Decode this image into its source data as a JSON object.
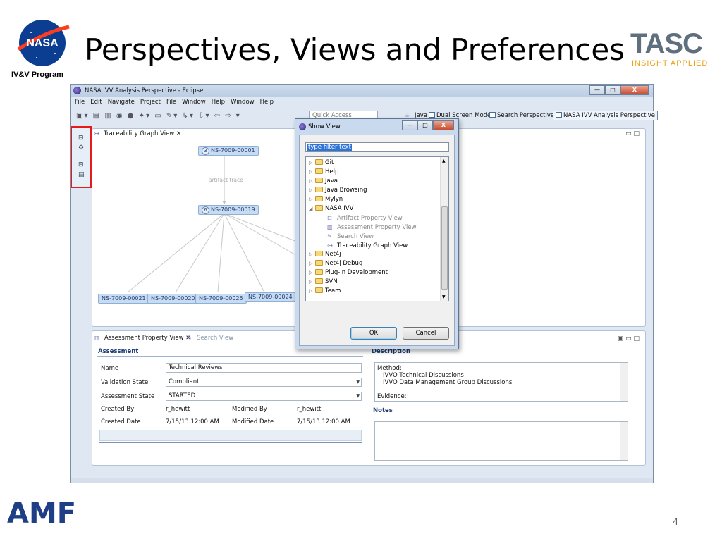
{
  "slide": {
    "nasa_logo_text": "NASA",
    "program": "IV&V Program",
    "title": "Perspectives, Views and Preferences",
    "tasc": "TASC",
    "tasc_tagline": "INSIGHT APPLIED",
    "footer_logo": "AMF",
    "page_number": "4"
  },
  "window": {
    "title": "NASA IVV Analysis Perspective - Eclipse",
    "controls": {
      "minimize": "—",
      "maximize": "□",
      "close": "X"
    }
  },
  "menubar": [
    "File",
    "Edit",
    "Navigate",
    "Project",
    "File",
    "Window",
    "Help",
    "Window",
    "Help"
  ],
  "toolbar": {
    "quick_access": "Quick Access",
    "perspectives": [
      "Java",
      "Dual Screen Mode",
      "Search Perspective",
      "NASA IVV Analysis Perspective"
    ]
  },
  "graph_view": {
    "tab_label": "Traceability Graph View",
    "edge_label": "artifact trace",
    "nodes": [
      {
        "count": "3",
        "label": "NS-7009-00001"
      },
      {
        "count": "6",
        "label": "NS-7009-00019"
      }
    ],
    "leaves": [
      "NS-7009-00021",
      "NS-7009-00020",
      "NS-7009-00025",
      "NS-7009-00024"
    ]
  },
  "assessment_view": {
    "tab_label": "Assessment Property View",
    "tab2_label": "Search View",
    "section": "Assessment",
    "fields": {
      "name_label": "Name",
      "name_value": "Technical Reviews",
      "validation_label": "Validation State",
      "validation_value": "Compliant",
      "assessment_label": "Assessment State",
      "assessment_value": "STARTED",
      "created_by_label": "Created By",
      "created_by_value": "r_hewitt",
      "modified_by_label": "Modified By",
      "modified_by_value": "r_hewitt",
      "created_date_label": "Created Date",
      "created_date_value": "7/15/13 12:00 AM",
      "modified_date_label": "Modified Date",
      "modified_date_value": "7/15/13 12:00 AM"
    },
    "description_section": "Description",
    "description_lines": [
      "Method:",
      "IVVO Technical Discussions",
      "IVVO Data Management Group Discussions",
      "Evidence:"
    ],
    "notes_section": "Notes"
  },
  "dialog": {
    "title": "Show View",
    "filter_placeholder": "type filter text",
    "tree": [
      {
        "label": "Git",
        "expanded": false
      },
      {
        "label": "Help",
        "expanded": false
      },
      {
        "label": "Java",
        "expanded": false
      },
      {
        "label": "Java Browsing",
        "expanded": false
      },
      {
        "label": "Mylyn",
        "expanded": false
      },
      {
        "label": "NASA IVV",
        "expanded": true
      },
      {
        "label": "Artifact Property View",
        "child": true
      },
      {
        "label": "Assessment Property View",
        "child": true
      },
      {
        "label": "Search View",
        "child": true
      },
      {
        "label": "Traceability Graph View",
        "child": true
      },
      {
        "label": "Net4j",
        "expanded": false
      },
      {
        "label": "Net4j Debug",
        "expanded": false
      },
      {
        "label": "Plug-in Development",
        "expanded": false
      },
      {
        "label": "SVN",
        "expanded": false
      },
      {
        "label": "Team",
        "expanded": false
      }
    ],
    "ok": "OK",
    "cancel": "Cancel"
  },
  "colors": {
    "accent_red": "#e51a1a",
    "node_fill": "#c7dcf2",
    "title_blue": "#1e3f86",
    "tasc_orange": "#e8a21b"
  }
}
